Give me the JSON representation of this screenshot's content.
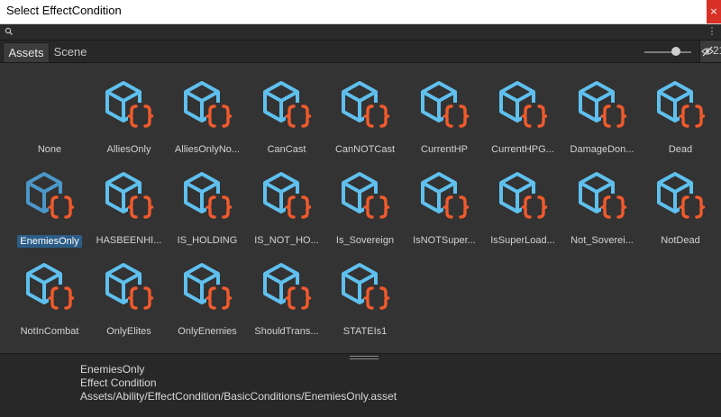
{
  "window": {
    "title": "Select EffectCondition",
    "close_label": "×"
  },
  "search": {
    "value": "",
    "placeholder": "",
    "clear_label": "⋮"
  },
  "tabs": [
    {
      "label": "Assets",
      "active": true
    },
    {
      "label": "Scene",
      "active": false
    }
  ],
  "toolbar": {
    "hidden_count": "21"
  },
  "colors": {
    "script_icon_cube": "#5fc0ee",
    "script_icon_braces": "#f05a2c",
    "selection": "#2c5d87"
  },
  "assets": [
    {
      "label": "None",
      "icon": "none"
    },
    {
      "label": "AlliesOnly",
      "icon": "script-icon"
    },
    {
      "label": "AlliesOnlyNo...",
      "icon": "script-icon"
    },
    {
      "label": "CanCast",
      "icon": "script-icon"
    },
    {
      "label": "CanNOTCast",
      "icon": "script-icon"
    },
    {
      "label": "CurrentHP",
      "icon": "script-icon"
    },
    {
      "label": "CurrentHPG...",
      "icon": "script-icon"
    },
    {
      "label": "DamageDon...",
      "icon": "script-icon"
    },
    {
      "label": "Dead",
      "icon": "script-icon"
    },
    {
      "label": "EnemiesOnly",
      "icon": "script-icon",
      "selected": true
    },
    {
      "label": "HASBEENHI...",
      "icon": "script-icon"
    },
    {
      "label": "IS_HOLDING",
      "icon": "script-icon"
    },
    {
      "label": "IS_NOT_HO...",
      "icon": "script-icon"
    },
    {
      "label": "Is_Sovereign",
      "icon": "script-icon"
    },
    {
      "label": "IsNOTSuper...",
      "icon": "script-icon"
    },
    {
      "label": "IsSuperLoad...",
      "icon": "script-icon"
    },
    {
      "label": "Not_Soverei...",
      "icon": "script-icon"
    },
    {
      "label": "NotDead",
      "icon": "script-icon"
    },
    {
      "label": "NotInCombat",
      "icon": "script-icon"
    },
    {
      "label": "OnlyElites",
      "icon": "script-icon"
    },
    {
      "label": "OnlyEnemies",
      "icon": "script-icon"
    },
    {
      "label": "ShouldTrans...",
      "icon": "script-icon"
    },
    {
      "label": "STATEIs1",
      "icon": "script-icon"
    }
  ],
  "info": {
    "name": "EnemiesOnly",
    "type": "Effect Condition",
    "path": "Assets/Ability/EffectCondition/BasicConditions/EnemiesOnly.asset"
  }
}
